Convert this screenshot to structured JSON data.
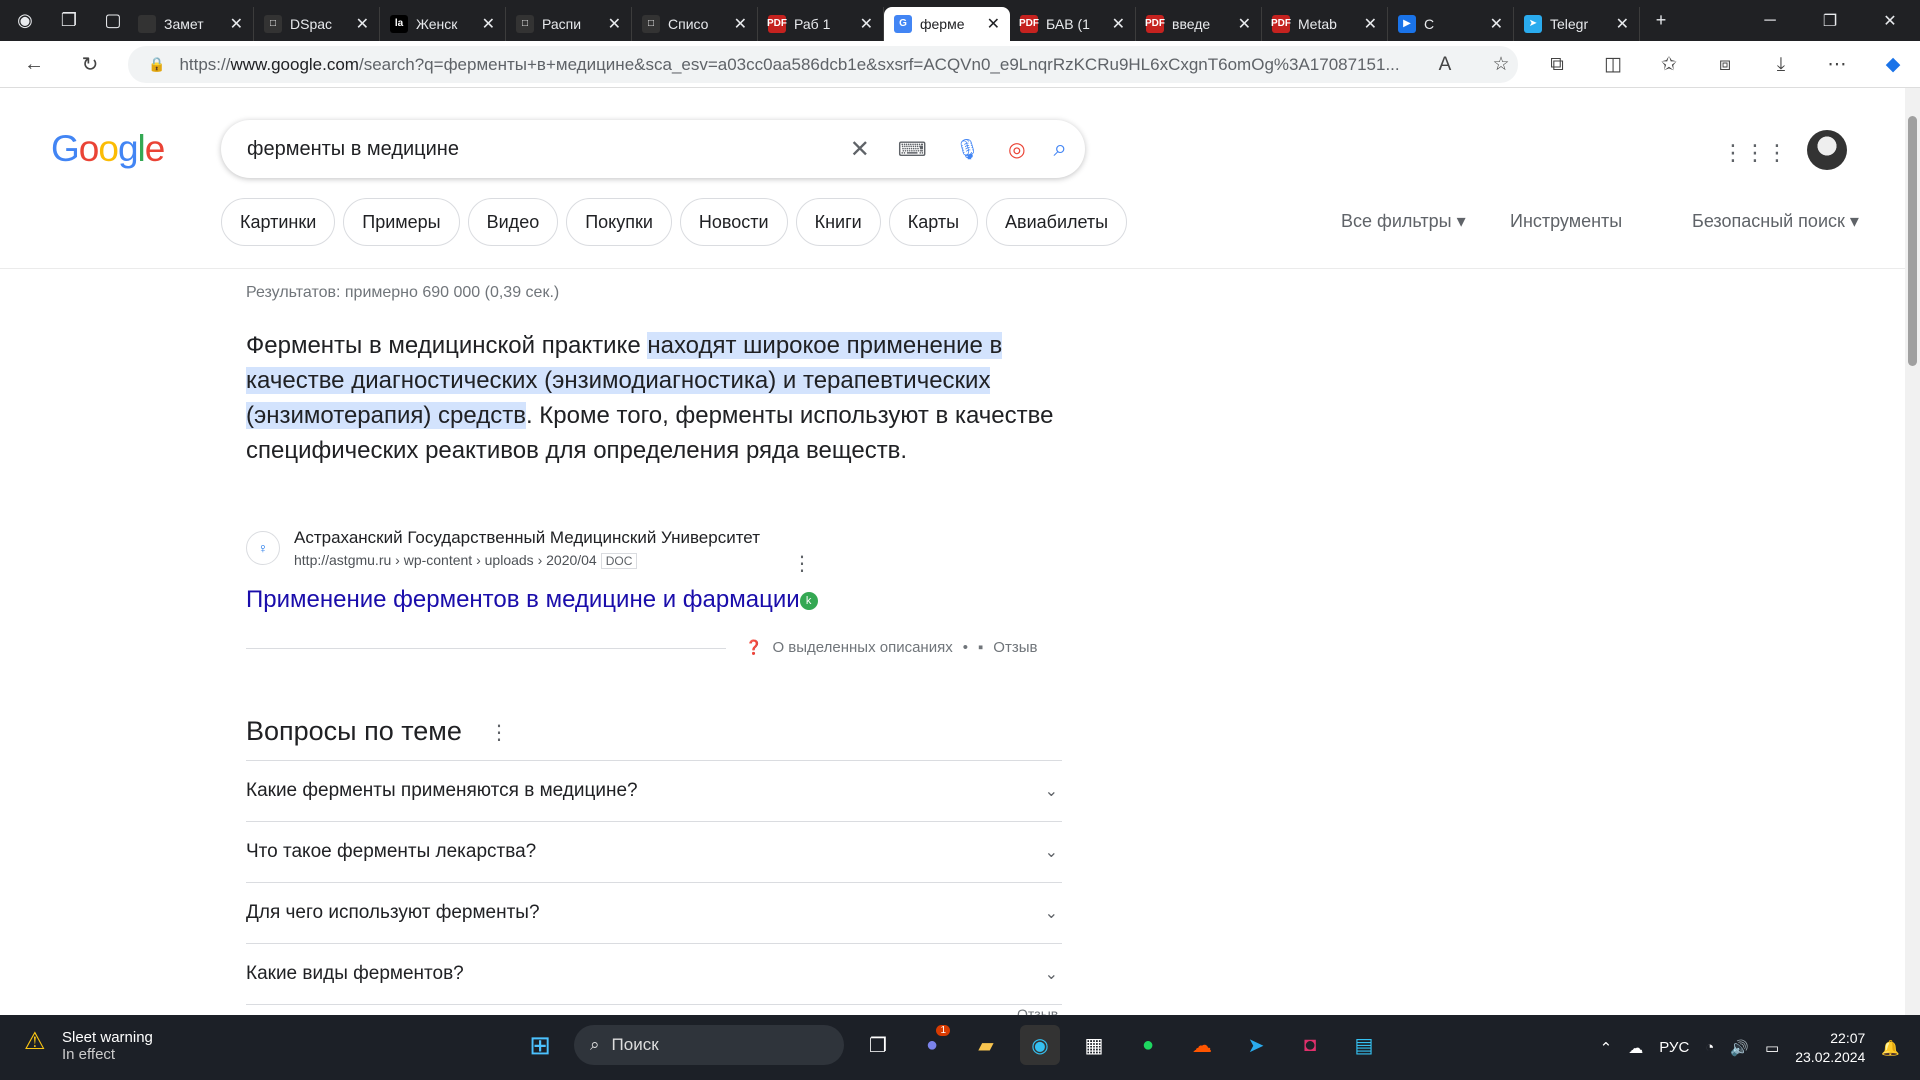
{
  "browser": {
    "tabs": [
      {
        "label": "Замет",
        "fav_color": "#333333",
        "fav_glyph": ""
      },
      {
        "label": "DSpac",
        "fav_color": "#333333",
        "fav_glyph": "□"
      },
      {
        "label": "Женск",
        "fav_color": "#000000",
        "fav_glyph": "la"
      },
      {
        "label": "Распи",
        "fav_color": "#333333",
        "fav_glyph": "□"
      },
      {
        "label": "Списо",
        "fav_color": "#333333",
        "fav_glyph": "□"
      },
      {
        "label": "Раб 1",
        "fav_color": "#c5221f",
        "fav_glyph": "PDF"
      },
      {
        "label": "ферме",
        "fav_color": "#4285f4",
        "fav_glyph": "G",
        "active": true
      },
      {
        "label": "БАВ (1",
        "fav_color": "#c5221f",
        "fav_glyph": "PDF"
      },
      {
        "label": "введе",
        "fav_color": "#c5221f",
        "fav_glyph": "PDF"
      },
      {
        "label": "Metab",
        "fav_color": "#c5221f",
        "fav_glyph": "PDF"
      },
      {
        "label": "С",
        "fav_color": "#1a73e8",
        "fav_glyph": "▶"
      },
      {
        "label": "Telegr",
        "fav_color": "#2aabee",
        "fav_glyph": "➤"
      }
    ],
    "url_prefix": "https://",
    "url_domain": "www.google.com",
    "url_rest": "/search?q=ферменты+в+медицине&sca_esv=a03cc0aa586dcb1e&sxsrf=ACQVn0_e9LnqrRzKCRu9HL6xCxgnT6omOg%3A17087151..."
  },
  "google": {
    "logo": "Google",
    "query": "ферменты в медицине",
    "chips": [
      "Картинки",
      "Примеры",
      "Видео",
      "Покупки",
      "Новости",
      "Книги",
      "Карты",
      "Авиабилеты"
    ],
    "all_filters": "Все фильтры",
    "tools": "Инструменты",
    "safe_search": "Безопасный поиск",
    "stats": "Результатов: примерно 690 000 (0,39 сек.)",
    "snippet_pre": "Ферменты в медицинской практике ",
    "snippet_hl": "находят широкое применение в качестве диагностических (энзимодиагностика) и терапевтических (энзимотерапия) средств",
    "snippet_post": ". Кроме того, ферменты используют в качестве специфических реактивов для определения ряда веществ.",
    "source_name": "Астраханский Государственный Медицинский Университет",
    "source_url": "http://astgmu.ru › wp-content › uploads › 2020/04",
    "source_doc": "DOC",
    "result_title": "Применение ферментов в медицине и фармации",
    "badge": "k",
    "featured_about": "О выделенных описаниях",
    "featured_sep": "•",
    "featured_feedback": "Отзыв",
    "paa_title": "Вопросы по теме",
    "paa": [
      "Какие ферменты применяются в медицине?",
      "Что такое ферменты лекарства?",
      "Для чего используют ферменты?",
      "Какие виды ферментов?"
    ],
    "paa_feedback": "Отзыв"
  },
  "taskbar": {
    "weather_title": "Sleet warning",
    "weather_sub": "In effect",
    "search_label": "Поиск",
    "lang": "РУС",
    "time": "22:07",
    "date": "23.02.2024",
    "chat_badge": "1"
  }
}
